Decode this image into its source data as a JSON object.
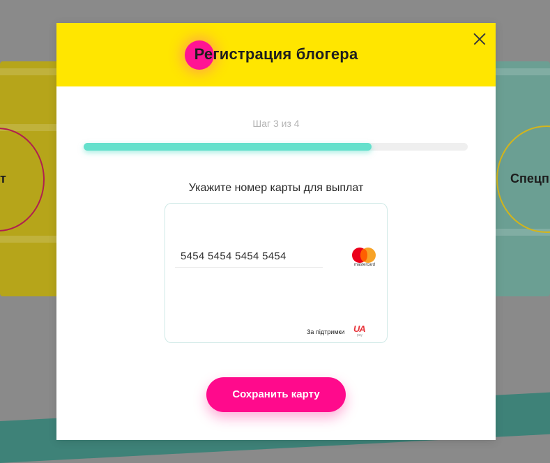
{
  "background": {
    "left_word": "т",
    "right_word": "Спецп"
  },
  "modal": {
    "title": "Регистрация блогера",
    "step_label": "Шаг 3 из 4",
    "progress": {
      "current_step": 3,
      "total_steps": 4,
      "fill_fraction": 0.75
    },
    "card_heading": "Укажите номер карты для выплат",
    "card": {
      "number_value": "5454 5454 5454 5454",
      "brand_text": "mastercard",
      "support_text": "За підтримки",
      "payment_logo_text": "UA",
      "payment_logo_sub": "pay"
    },
    "save_button_label": "Сохранить карту"
  },
  "colors": {
    "header_bg": "#ffe600",
    "accent_pink": "#ff0a8c",
    "progress_fill": "#64e0cc",
    "progress_track": "#efefef",
    "step_label": "#b3b3b3"
  },
  "icons": {
    "close": "close-icon",
    "header_decor": "pink-dot-icon",
    "card_brand": "mastercard-icon",
    "payment_provider": "uapay-icon"
  }
}
